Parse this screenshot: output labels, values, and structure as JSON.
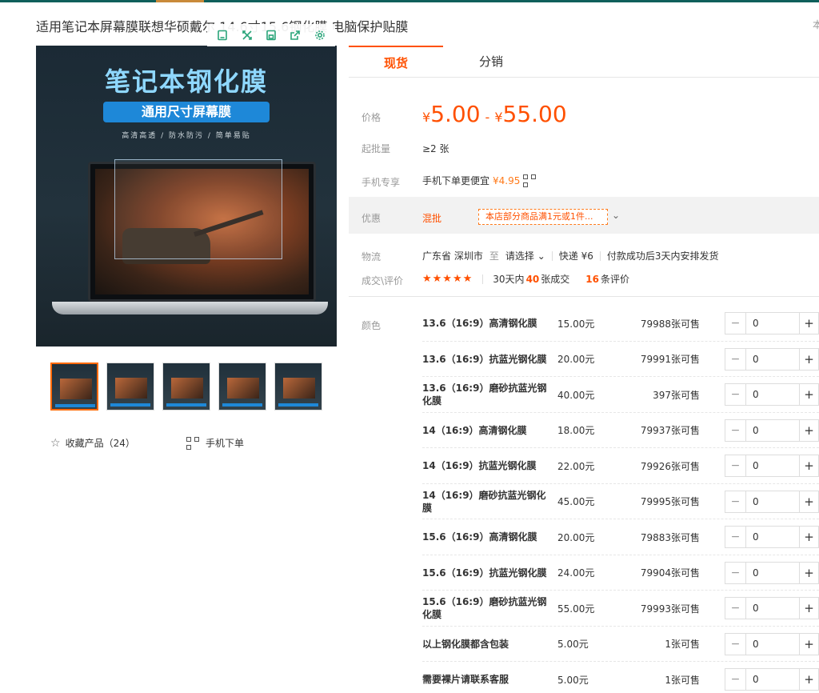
{
  "window": {
    "title": "适用笔记本屏幕膜联想华硕戴尔 14.6寸15.6钢化膜 电脑保护贴膜",
    "right_hint": "本"
  },
  "main_image": {
    "title": "笔记本钢化膜",
    "pill": "通用尺寸屏幕膜",
    "subtitle": "高清高透 / 防水防污 / 简单易贴"
  },
  "toolbar": {
    "icons": [
      "bookmark-icon",
      "expand-icon",
      "save-icon",
      "share-icon",
      "settings-icon"
    ]
  },
  "thumbnails": [
    {
      "active": true
    },
    {
      "active": false
    },
    {
      "active": false
    },
    {
      "active": false
    },
    {
      "active": false
    }
  ],
  "actions": {
    "favorite_label": "收藏产品（24）",
    "mobile_order_label": "手机下单"
  },
  "tabs": {
    "active": "现货",
    "other": "分销"
  },
  "price": {
    "label": "价格",
    "currency": "¥",
    "min": "5.00",
    "max": "55.00",
    "dash": "-"
  },
  "moq": {
    "label": "起批量",
    "value": "≥2 张"
  },
  "mobile": {
    "label": "手机专享",
    "text": "手机下单更便宜",
    "price": "¥4.95"
  },
  "promo": {
    "label": "优惠",
    "tag": "混批",
    "box": "本店部分商品满1元或1件...",
    "chevron": "⌄"
  },
  "logistics": {
    "label": "物流",
    "from": "广东省 深圳市",
    "to_word": "至",
    "select": "请选择",
    "express": "快递 ¥6",
    "note": "付款成功后3天内安排发货"
  },
  "deal": {
    "label": "成交\\评价",
    "stars": "★★★★★",
    "prefix": "30天内",
    "count": "40",
    "count_suffix": "张成交",
    "reviews": "16",
    "reviews_suffix": "条评价"
  },
  "variants": {
    "label": "颜色",
    "rows": [
      {
        "name": "13.6（16:9）高清钢化膜",
        "price": "15.00元",
        "stock": "79988张可售",
        "qty": "0"
      },
      {
        "name": "13.6（16:9）抗蓝光钢化膜",
        "price": "20.00元",
        "stock": "79991张可售",
        "qty": "0"
      },
      {
        "name": "13.6（16:9）磨砂抗蓝光钢化膜",
        "price": "40.00元",
        "stock": "397张可售",
        "qty": "0"
      },
      {
        "name": "14（16:9）高清钢化膜",
        "price": "18.00元",
        "stock": "79937张可售",
        "qty": "0"
      },
      {
        "name": "14（16:9）抗蓝光钢化膜",
        "price": "22.00元",
        "stock": "79926张可售",
        "qty": "0"
      },
      {
        "name": "14（16:9）磨砂抗蓝光钢化膜",
        "price": "45.00元",
        "stock": "79995张可售",
        "qty": "0"
      },
      {
        "name": "15.6（16:9）高清钢化膜",
        "price": "20.00元",
        "stock": "79883张可售",
        "qty": "0"
      },
      {
        "name": "15.6（16:9）抗蓝光钢化膜",
        "price": "24.00元",
        "stock": "79904张可售",
        "qty": "0"
      },
      {
        "name": "15.6（16:9）磨砂抗蓝光钢化膜",
        "price": "55.00元",
        "stock": "79993张可售",
        "qty": "0"
      },
      {
        "name": "以上钢化膜都含包装",
        "price": "5.00元",
        "stock": "1张可售",
        "qty": "0"
      },
      {
        "name": "需要裸片请联系客服",
        "price": "5.00元",
        "stock": "1张可售",
        "qty": "0"
      }
    ]
  },
  "colors": {
    "accent": "#ff5000",
    "header_bar": "#0f5f5b",
    "toolbar_icon": "#2aa57a"
  }
}
